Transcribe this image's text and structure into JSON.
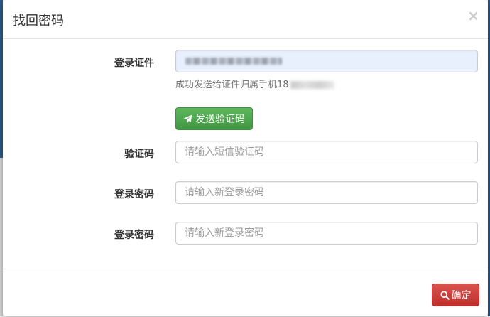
{
  "modal": {
    "title": "找回密码",
    "close_symbol": "×"
  },
  "form": {
    "certificate": {
      "label": "登录证件",
      "value_masked": true
    },
    "help_text": "成功发送给证件归属手机18",
    "send_code_button": {
      "label": "发送验证码",
      "icon": "send-icon"
    },
    "sms_code": {
      "label": "验证码",
      "placeholder": "请输入短信验证码"
    },
    "new_password": {
      "label": "登录密码",
      "placeholder": "请输入新登录密码"
    },
    "confirm_password": {
      "label": "登录密码",
      "placeholder": "请输入新登录密码"
    }
  },
  "footer": {
    "confirm_button": {
      "label": "确定",
      "icon": "search-icon"
    }
  },
  "colors": {
    "success": "#5cb85c",
    "danger": "#d9534f",
    "autofill_bg": "#e8f0fe"
  }
}
